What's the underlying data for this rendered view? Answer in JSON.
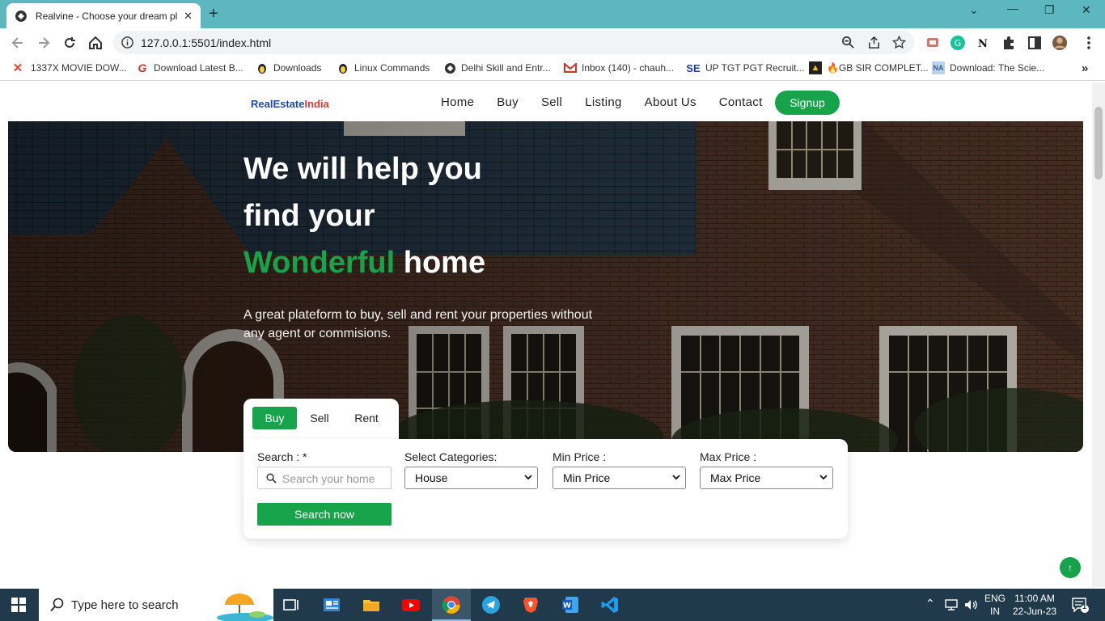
{
  "browser": {
    "tab_title": "Realvine - Choose your dream pl",
    "url": "127.0.0.1:5501/index.html",
    "bookmarks": [
      {
        "label": "1337X MOVIE DOW...",
        "icon": "x-icon"
      },
      {
        "label": "Download Latest B...",
        "icon": "g-icon"
      },
      {
        "label": "Downloads",
        "icon": "linux-icon"
      },
      {
        "label": "Linux Commands",
        "icon": "linux-icon"
      },
      {
        "label": "Delhi Skill and Entr...",
        "icon": "globe-icon"
      },
      {
        "label": "Inbox (140) - chauh...",
        "icon": "gmail-icon"
      },
      {
        "label": "UP TGT PGT Recruit...",
        "icon": "se-icon"
      },
      {
        "label": "🔥GB SIR COMPLET...",
        "icon": "gb-icon"
      },
      {
        "label": "Download: The Scie...",
        "icon": "na-icon"
      }
    ]
  },
  "site": {
    "logo_part1": "RealEstate",
    "logo_part2": "India",
    "nav": [
      "Home",
      "Buy",
      "Sell",
      "Listing",
      "About Us",
      "Contact"
    ],
    "signup": "Signup",
    "hero": {
      "line1": "We will help you",
      "line2": "find your",
      "line3_green": "Wonderful",
      "line3_rest": "home",
      "subtitle": "A great plateform to buy, sell and rent your properties without any agent or commisions."
    },
    "search_tabs": [
      "Buy",
      "Sell",
      "Rent"
    ],
    "form": {
      "search_label": "Search : *",
      "search_placeholder": "Search your home",
      "category_label": "Select Categories:",
      "category_value": "House",
      "min_label": "Min Price :",
      "min_value": "Min Price",
      "max_label": "Max Price :",
      "max_value": "Max Price",
      "button": "Search now"
    },
    "to_top": "↑",
    "accent": "#16a34a"
  },
  "taskbar": {
    "search_placeholder": "Type here to search",
    "lang_top": "ENG",
    "lang_bottom": "IN",
    "time": "11:00 AM",
    "date": "22-Jun-23",
    "notif_count": "1"
  }
}
